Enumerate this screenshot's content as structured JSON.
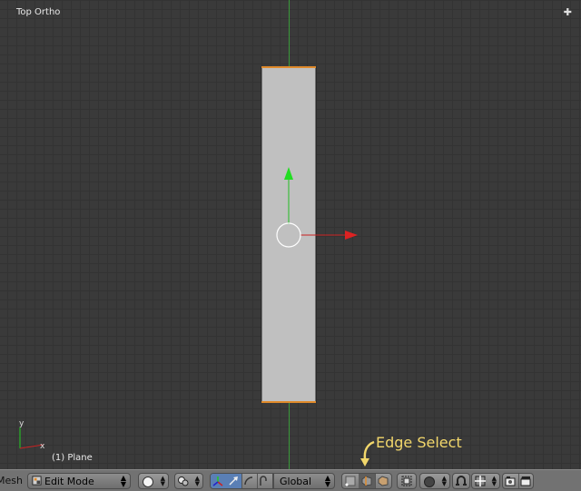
{
  "viewport": {
    "view_title": "Top Ortho",
    "object_name": "(1) Plane",
    "axis_y_label": "y",
    "axis_x_label": "x",
    "colors": {
      "background": "#3a3a3a",
      "grid": "#333333",
      "plane": "#c0c0c0",
      "selected_edge": "#e08a2a",
      "x_axis": "#cc2222",
      "y_axis": "#22cc22"
    },
    "corner_icon": "plus-icon"
  },
  "annotation": {
    "text": "Edge Select",
    "color": "#f2d76b"
  },
  "header": {
    "menu_label": "Mesh",
    "mode_select": {
      "value": "Edit Mode",
      "icon": "edit-mode-icon"
    },
    "pivot_icon": "pivot-point-icon",
    "orientation_select": {
      "value": "Global"
    },
    "select_modes": [
      "vertex-select-icon",
      "edge-select-icon",
      "face-select-icon"
    ],
    "icons": [
      "occlude-geometry-icon",
      "proportional-edit-icon",
      "snap-icon",
      "snap-element-icon",
      "render-icon",
      "clapper-icon"
    ]
  }
}
